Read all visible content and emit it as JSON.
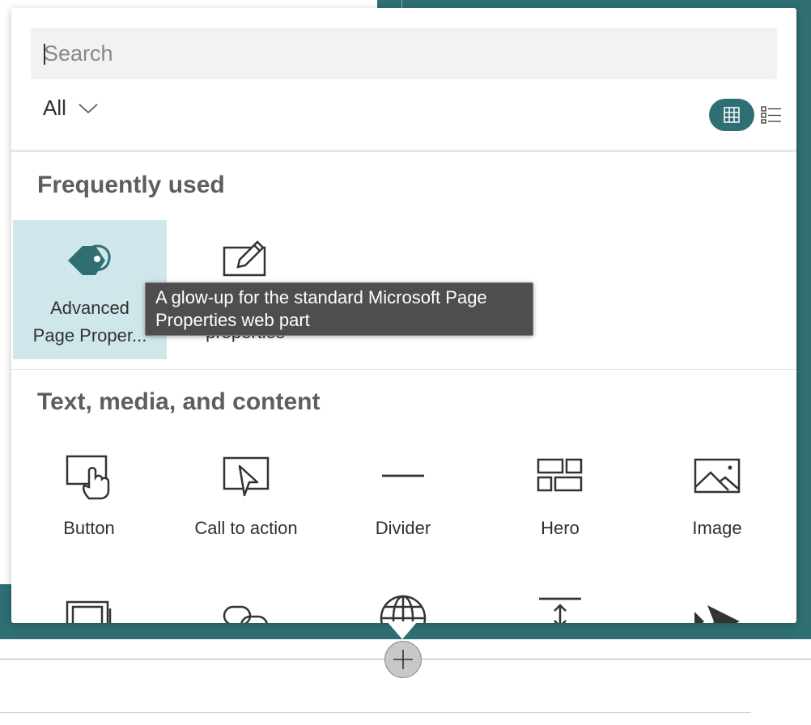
{
  "search": {
    "placeholder": "Search",
    "value": ""
  },
  "filter": {
    "selected": "All"
  },
  "view_toggle": {
    "active": "grid",
    "accent_color": "#2f6f73"
  },
  "sections": {
    "frequently_used": {
      "title": "Frequently used",
      "items": [
        {
          "label_line1": "Advanced",
          "label_line2": "Page Proper...",
          "icon": "tag-icon",
          "selected": true
        },
        {
          "label_line1": "",
          "label_line2": "properties",
          "icon": "edit-icon",
          "selected": false
        }
      ]
    },
    "text_media_content": {
      "title": "Text, media, and content",
      "items": [
        {
          "label": "Button",
          "icon": "button-icon"
        },
        {
          "label": "Call to action",
          "icon": "call-to-action-icon"
        },
        {
          "label": "Divider",
          "icon": "divider-icon"
        },
        {
          "label": "Hero",
          "icon": "hero-icon"
        },
        {
          "label": "Image",
          "icon": "image-icon"
        },
        {
          "label": "",
          "icon": "image-gallery-icon"
        },
        {
          "label": "",
          "icon": "link-icon"
        },
        {
          "label": "",
          "icon": "globe-icon"
        },
        {
          "label": "",
          "icon": "spacer-icon"
        },
        {
          "label": "",
          "icon": "stream-icon"
        }
      ]
    }
  },
  "tooltip": {
    "line1": "A glow-up for the standard Microsoft Page",
    "line2": "Properties web part"
  },
  "colors": {
    "teal": "#2f6f73",
    "selected_tile": "#cfe7ea",
    "tooltip_bg": "#4e4e4f"
  }
}
